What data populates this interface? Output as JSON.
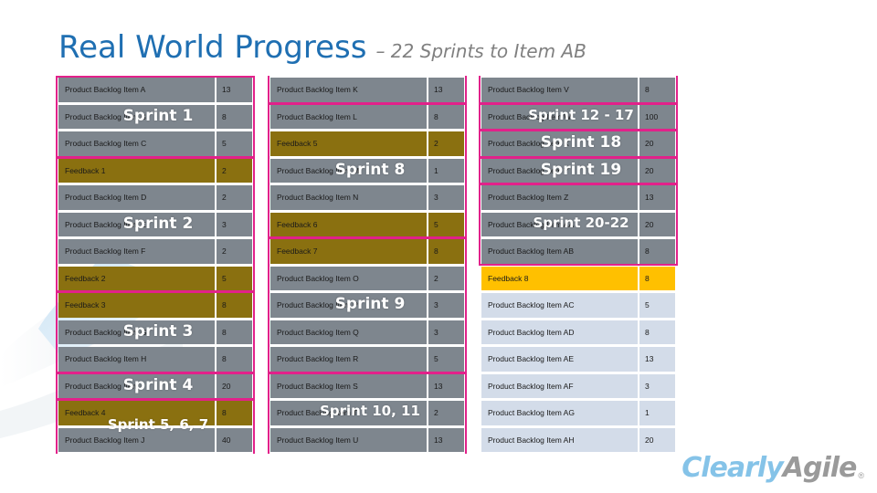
{
  "title": {
    "main": "Real World Progress",
    "sub": "– 22 Sprints to Item AB"
  },
  "logo": {
    "part1": "Clearly",
    "part2": "Agile",
    "registered": "®"
  },
  "colors": {
    "title": "#1F6FB2",
    "subtitle": "#808080",
    "sprint_outline": "#E2218A",
    "row_gray": "#7E868E",
    "row_olive": "#8A7010",
    "row_blue": "#D3DCE9",
    "row_gold": "#FFC000",
    "logo_blue": "#85C3E8",
    "logo_gray": "#9A9A9A"
  },
  "columns": [
    {
      "id": "col-1",
      "rows": [
        {
          "name": "Product Backlog Item A",
          "value": "13",
          "theme": "gray"
        },
        {
          "name": "Product Backlog Item B",
          "value": "8",
          "theme": "gray"
        },
        {
          "name": "Product Backlog Item C",
          "value": "5",
          "theme": "gray"
        },
        {
          "name": "Feedback 1",
          "value": "2",
          "theme": "olive"
        },
        {
          "name": "Product Backlog Item D",
          "value": "2",
          "theme": "gray"
        },
        {
          "name": "Product Backlog Item E",
          "value": "3",
          "theme": "gray"
        },
        {
          "name": "Product Backlog Item F",
          "value": "2",
          "theme": "gray"
        },
        {
          "name": "Feedback 2",
          "value": "5",
          "theme": "olive"
        },
        {
          "name": "Feedback 3",
          "value": "8",
          "theme": "olive"
        },
        {
          "name": "Product Backlog Item G",
          "value": "8",
          "theme": "gray"
        },
        {
          "name": "Product Backlog Item H",
          "value": "8",
          "theme": "gray"
        },
        {
          "name": "Product Backlog Item I",
          "value": "20",
          "theme": "gray"
        },
        {
          "name": "Feedback 4",
          "value": "8",
          "theme": "olive"
        },
        {
          "name": "Product Backlog Item J",
          "value": "40",
          "theme": "gray"
        }
      ],
      "sprints": [
        {
          "label": "Sprint 1",
          "start": 0,
          "span": 3
        },
        {
          "label": "Sprint 2",
          "start": 3,
          "span": 5
        },
        {
          "label": "Sprint 3",
          "start": 8,
          "span": 3
        },
        {
          "label": "Sprint 4",
          "start": 11,
          "span": 1
        },
        {
          "label": "Sprint 5, 6, 7",
          "start": 12,
          "span": 2,
          "small": true,
          "open_bottom": true
        }
      ]
    },
    {
      "id": "col-2",
      "rows": [
        {
          "name": "Product Backlog Item K",
          "value": "13",
          "theme": "gray"
        },
        {
          "name": "Product Backlog Item L",
          "value": "8",
          "theme": "gray"
        },
        {
          "name": "Feedback 5",
          "value": "2",
          "theme": "olive"
        },
        {
          "name": "Product Backlog Item M",
          "value": "1",
          "theme": "gray"
        },
        {
          "name": "Product Backlog Item N",
          "value": "3",
          "theme": "gray"
        },
        {
          "name": "Feedback 6",
          "value": "5",
          "theme": "olive"
        },
        {
          "name": "Feedback 7",
          "value": "8",
          "theme": "olive"
        },
        {
          "name": "Product Backlog Item O",
          "value": "2",
          "theme": "gray"
        },
        {
          "name": "Product Backlog Item P",
          "value": "3",
          "theme": "gray"
        },
        {
          "name": "Product Backlog Item Q",
          "value": "3",
          "theme": "gray"
        },
        {
          "name": "Product Backlog Item R",
          "value": "5",
          "theme": "gray"
        },
        {
          "name": "Product Backlog Item S",
          "value": "13",
          "theme": "gray"
        },
        {
          "name": "Product Backlog Item T",
          "value": "2",
          "theme": "gray"
        },
        {
          "name": "Product Backlog Item U",
          "value": "13",
          "theme": "gray"
        }
      ],
      "sprints": [
        {
          "label": "",
          "start": 0,
          "span": 1,
          "open_top": true
        },
        {
          "label": "Sprint 8",
          "start": 1,
          "span": 5
        },
        {
          "label": "Sprint 9",
          "start": 6,
          "span": 5
        },
        {
          "label": "Sprint 10, 11",
          "start": 11,
          "span": 3,
          "small": true,
          "open_bottom": true
        }
      ]
    },
    {
      "id": "col-3",
      "rows": [
        {
          "name": "Product Backlog Item V",
          "value": "8",
          "theme": "gray"
        },
        {
          "name": "Product Backlog Item W",
          "value": "100",
          "theme": "gray"
        },
        {
          "name": "Product Backlog Item X",
          "value": "20",
          "theme": "gray"
        },
        {
          "name": "Product Backlog Item Y",
          "value": "20",
          "theme": "gray"
        },
        {
          "name": "Product Backlog Item Z",
          "value": "13",
          "theme": "gray"
        },
        {
          "name": "Product Backlog Item AA",
          "value": "20",
          "theme": "gray"
        },
        {
          "name": "Product Backlog Item AB",
          "value": "8",
          "theme": "gray"
        },
        {
          "name": "Feedback 8",
          "value": "8",
          "theme": "gold"
        },
        {
          "name": "Product Backlog Item AC",
          "value": "5",
          "theme": "blue"
        },
        {
          "name": "Product Backlog Item AD",
          "value": "8",
          "theme": "blue"
        },
        {
          "name": "Product Backlog Item AE",
          "value": "13",
          "theme": "blue"
        },
        {
          "name": "Product Backlog Item AF",
          "value": "3",
          "theme": "blue"
        },
        {
          "name": "Product Backlog Item AG",
          "value": "1",
          "theme": "blue"
        },
        {
          "name": "Product Backlog Item AH",
          "value": "20",
          "theme": "blue"
        }
      ],
      "sprints": [
        {
          "label": "",
          "start": 0,
          "span": 1,
          "open_top": true
        },
        {
          "label": "Sprint 12 - 17",
          "start": 1,
          "span": 1,
          "small": true
        },
        {
          "label": "Sprint 18",
          "start": 2,
          "span": 1
        },
        {
          "label": "Sprint 19",
          "start": 3,
          "span": 1
        },
        {
          "label": "Sprint 20-22",
          "start": 4,
          "span": 3,
          "small": true
        }
      ]
    }
  ]
}
